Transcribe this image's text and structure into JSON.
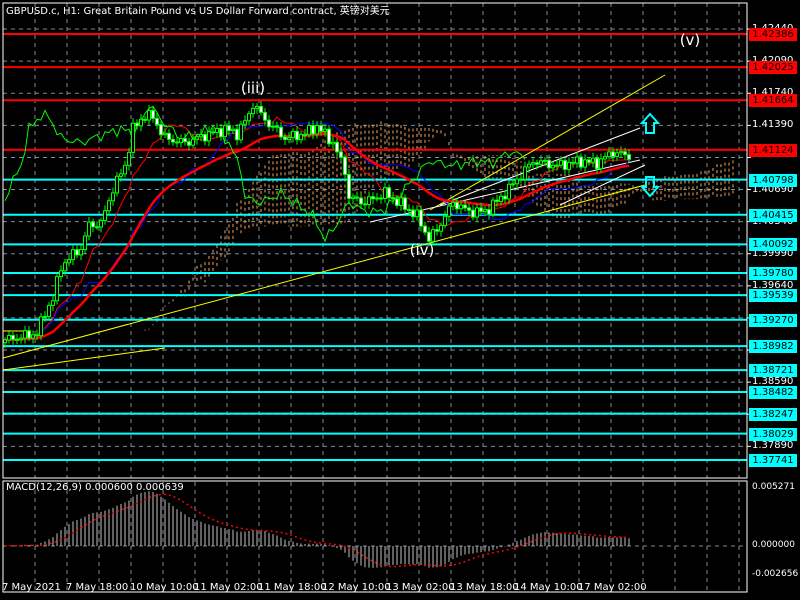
{
  "header": {
    "title": "GBPUSD.c, H1:  Great Britain Pound vs US Dollar Forward contract, 英镑对美元"
  },
  "colors": {
    "bull": "#00ff00",
    "bear": "#ffffff",
    "grid": "#7f8c99",
    "level_red": "#ff0000",
    "level_cyan": "#00ffff",
    "tenkan": "#ff0000",
    "kijun": "#0000ff",
    "ma": "#ff0000",
    "chikou": "#00ff00",
    "cloud": "#f4a460",
    "trend": "#ffff00",
    "signal": "#ff0000"
  },
  "price_axis": {
    "min": 1.3746,
    "max": 1.4276,
    "ticks": [
      "1.42440",
      "1.42090",
      "1.41740",
      "1.41390",
      "1.40690",
      "1.40340",
      "1.39990",
      "1.39640",
      "1.38590",
      "1.37890"
    ],
    "grid": [
      1.4244,
      1.4209,
      1.4174,
      1.4139,
      1.4104,
      1.4069,
      1.4034,
      1.3999,
      1.3964,
      1.3929,
      1.3894,
      1.3859,
      1.3824,
      1.3789
    ]
  },
  "levels": [
    {
      "label": "1.42386",
      "color": "red"
    },
    {
      "label": "1.42025",
      "color": "red"
    },
    {
      "label": "1.41664",
      "color": "red"
    },
    {
      "label": "1.41124",
      "color": "red"
    },
    {
      "label": "1.40798",
      "color": "cyan"
    },
    {
      "label": "1.40415",
      "color": "cyan"
    },
    {
      "label": "1.40092",
      "color": "cyan"
    },
    {
      "label": "1.39780",
      "color": "cyan"
    },
    {
      "label": "1.39539",
      "color": "cyan"
    },
    {
      "label": "1.39270",
      "color": "cyan"
    },
    {
      "label": "1.38982",
      "color": "cyan"
    },
    {
      "label": "1.38721",
      "color": "cyan"
    },
    {
      "label": "1.38482",
      "color": "cyan"
    },
    {
      "label": "1.38247",
      "color": "cyan"
    },
    {
      "label": "1.38029",
      "color": "cyan"
    },
    {
      "label": "1.37741",
      "color": "cyan"
    }
  ],
  "waves": {
    "iii": "(iii)",
    "iv": "(iv)",
    "v": "(v)"
  },
  "time_labels": [
    "7 May 2021",
    "7 May 18:00",
    "10 May 10:00",
    "11 May 02:00",
    "11 May 18:00",
    "12 May 10:00",
    "13 May 02:00",
    "13 May 18:00",
    "14 May 10:00",
    "17 May 02:00"
  ],
  "price_keypoints": [
    [
      0,
      1.3905
    ],
    [
      8,
      1.3912
    ],
    [
      10,
      1.3935
    ],
    [
      12,
      1.395
    ],
    [
      14,
      1.3985
    ],
    [
      17,
      1.3998
    ],
    [
      19,
      1.4005
    ],
    [
      21,
      1.403
    ],
    [
      24,
      1.4032
    ],
    [
      27,
      1.407
    ],
    [
      30,
      1.4095
    ],
    [
      32,
      1.4135
    ],
    [
      35,
      1.415
    ],
    [
      37,
      1.4148
    ],
    [
      40,
      1.4125
    ],
    [
      45,
      1.412
    ],
    [
      50,
      1.4128
    ],
    [
      55,
      1.4135
    ],
    [
      58,
      1.413
    ],
    [
      61,
      1.415
    ],
    [
      62,
      1.4163
    ],
    [
      65,
      1.4145
    ],
    [
      70,
      1.4125
    ],
    [
      75,
      1.413
    ],
    [
      78,
      1.4138
    ],
    [
      82,
      1.412
    ],
    [
      85,
      1.409
    ],
    [
      86,
      1.406
    ],
    [
      90,
      1.4055
    ],
    [
      95,
      1.4065
    ],
    [
      100,
      1.405
    ],
    [
      103,
      1.404
    ],
    [
      106,
      1.4015
    ],
    [
      108,
      1.4025
    ],
    [
      112,
      1.4055
    ],
    [
      116,
      1.4045
    ],
    [
      120,
      1.4045
    ],
    [
      124,
      1.406
    ],
    [
      128,
      1.408
    ],
    [
      132,
      1.41
    ],
    [
      138,
      1.4095
    ],
    [
      144,
      1.41
    ],
    [
      148,
      1.4098
    ],
    [
      152,
      1.411
    ],
    [
      156,
      1.4105
    ]
  ],
  "macd": {
    "title": "MACD(12,26,9) 0.000600 0.000639",
    "max_label": "0.005271",
    "zero_label": "0.000000",
    "min_label": "-0.002656",
    "max": 0.005271,
    "min": -0.002656
  }
}
